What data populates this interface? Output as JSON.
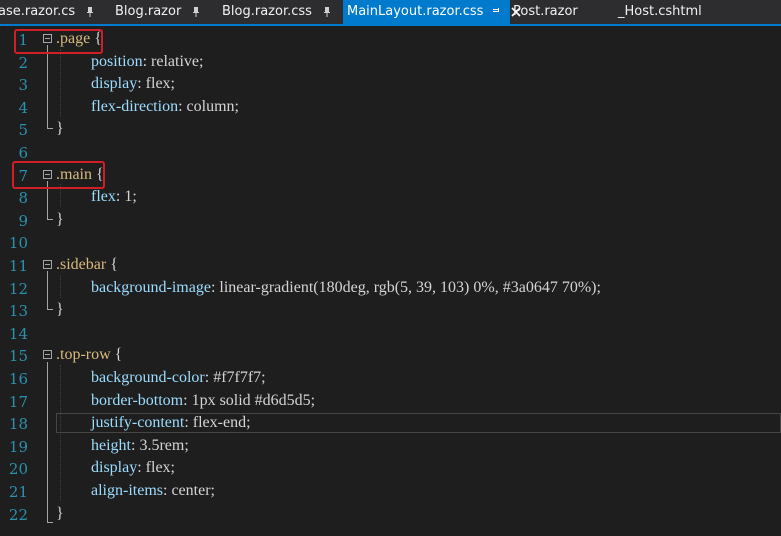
{
  "tabs": [
    {
      "label": "ase.razor.cs",
      "active": false,
      "pinned": true
    },
    {
      "label": "Blog.razor",
      "active": false,
      "pinned": true
    },
    {
      "label": "Blog.razor.css",
      "active": false,
      "pinned": true
    },
    {
      "label": "MainLayout.razor.css",
      "active": true,
      "pinned": true
    },
    {
      "label": "Post.razor",
      "active": false,
      "pinned": false
    },
    {
      "label": "_Host.cshtml",
      "active": false,
      "pinned": false
    }
  ],
  "colors": {
    "accent": "#007acc",
    "editor_bg": "#1e1e1e",
    "line_number": "#2b91af",
    "selector": "#d7ba7d",
    "property": "#9cdcfe",
    "highlight": "#d01f27"
  },
  "lines": [
    {
      "n": "1",
      "selector": ".page",
      "brace": " {"
    },
    {
      "n": "2",
      "prop": "position",
      "value": "relative;"
    },
    {
      "n": "3",
      "prop": "display",
      "value": "flex;"
    },
    {
      "n": "4",
      "prop": "flex-direction",
      "value": "column;"
    },
    {
      "n": "5",
      "close": "}"
    },
    {
      "n": "6"
    },
    {
      "n": "7",
      "selector": ".main",
      "brace": " {"
    },
    {
      "n": "8",
      "prop": "flex",
      "value": "1;"
    },
    {
      "n": "9",
      "close": "}"
    },
    {
      "n": "10"
    },
    {
      "n": "11",
      "selector": ".sidebar",
      "brace": " {"
    },
    {
      "n": "12",
      "prop": "background-image",
      "value": "linear-gradient(180deg, rgb(5, 39, 103) 0%, #3a0647 70%);"
    },
    {
      "n": "13",
      "close": "}"
    },
    {
      "n": "14"
    },
    {
      "n": "15",
      "selector": ".top-row",
      "brace": " {"
    },
    {
      "n": "16",
      "prop": "background-color",
      "value": "#f7f7f7;"
    },
    {
      "n": "17",
      "prop": "border-bottom",
      "value": "1px solid #d6d5d5;"
    },
    {
      "n": "18",
      "prop": "justify-content",
      "value": "flex-end;"
    },
    {
      "n": "19",
      "prop": "height",
      "value": "3.5rem;"
    },
    {
      "n": "20",
      "prop": "display",
      "value": "flex;"
    },
    {
      "n": "21",
      "prop": "align-items",
      "value": "center;"
    },
    {
      "n": "22",
      "close": "}"
    }
  ]
}
